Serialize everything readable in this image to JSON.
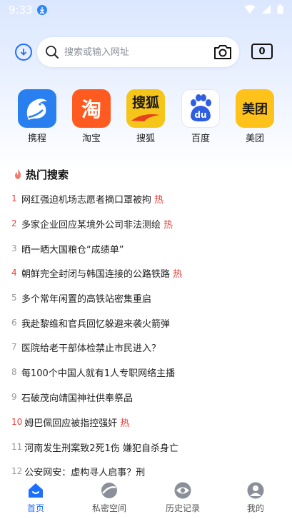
{
  "status_bar": {
    "time": "9:33"
  },
  "search": {
    "placeholder": "搜索或输入网址",
    "value": ""
  },
  "tabs": {
    "count": "0"
  },
  "shortcuts": [
    {
      "label": "携程",
      "icon": "ctrip-dolphin-icon",
      "color": "#2a7ff0"
    },
    {
      "label": "淘宝",
      "icon": "taobao-icon",
      "glyph": "淘",
      "color": "#ff5a1f"
    },
    {
      "label": "搜狐",
      "icon": "sohu-icon",
      "glyph": "搜狐",
      "color": "#f6c51a"
    },
    {
      "label": "百度",
      "icon": "baidu-paw-icon",
      "glyph": "du",
      "color": "#2f5fe0"
    },
    {
      "label": "美团",
      "icon": "meituan-icon",
      "glyph": "美团",
      "color": "#ffc21a"
    }
  ],
  "hot": {
    "title": "热门搜索",
    "items": [
      {
        "rank": "1",
        "text": "网红强迫机场志愿者摘口罩被拘",
        "tag": "热"
      },
      {
        "rank": "2",
        "text": "多家企业回应某境外公司非法测绘",
        "tag": "热"
      },
      {
        "rank": "3",
        "text": "晒一晒大国粮仓“成绩单”",
        "tag": ""
      },
      {
        "rank": "4",
        "text": "朝鲜完全封闭与韩国连接的公路铁路",
        "tag": "热"
      },
      {
        "rank": "5",
        "text": "多个常年闲置的高铁站密集重启",
        "tag": ""
      },
      {
        "rank": "6",
        "text": "我赴黎维和官兵回忆躲避来袭火箭弹",
        "tag": ""
      },
      {
        "rank": "7",
        "text": "医院给老干部体检禁止市民进入？",
        "tag": ""
      },
      {
        "rank": "8",
        "text": "每100个中国人就有1人专职网络主播",
        "tag": ""
      },
      {
        "rank": "9",
        "text": "石破茂向靖国神社供奉祭品",
        "tag": ""
      },
      {
        "rank": "10",
        "text": "姆巴佩回应被指控强奸",
        "tag": "热"
      },
      {
        "rank": "11",
        "text": "河南发生刑案致2死1伤 嫌犯自杀身亡",
        "tag": ""
      },
      {
        "rank": "12",
        "text": "公安网安：虚构寻人启事？刑",
        "tag": ""
      }
    ]
  },
  "nav": {
    "home": "首页",
    "private": "私密空间",
    "history": "历史记录",
    "mine": "我的"
  },
  "colors": {
    "accent": "#1e6fff",
    "hot": "#e8403a"
  }
}
